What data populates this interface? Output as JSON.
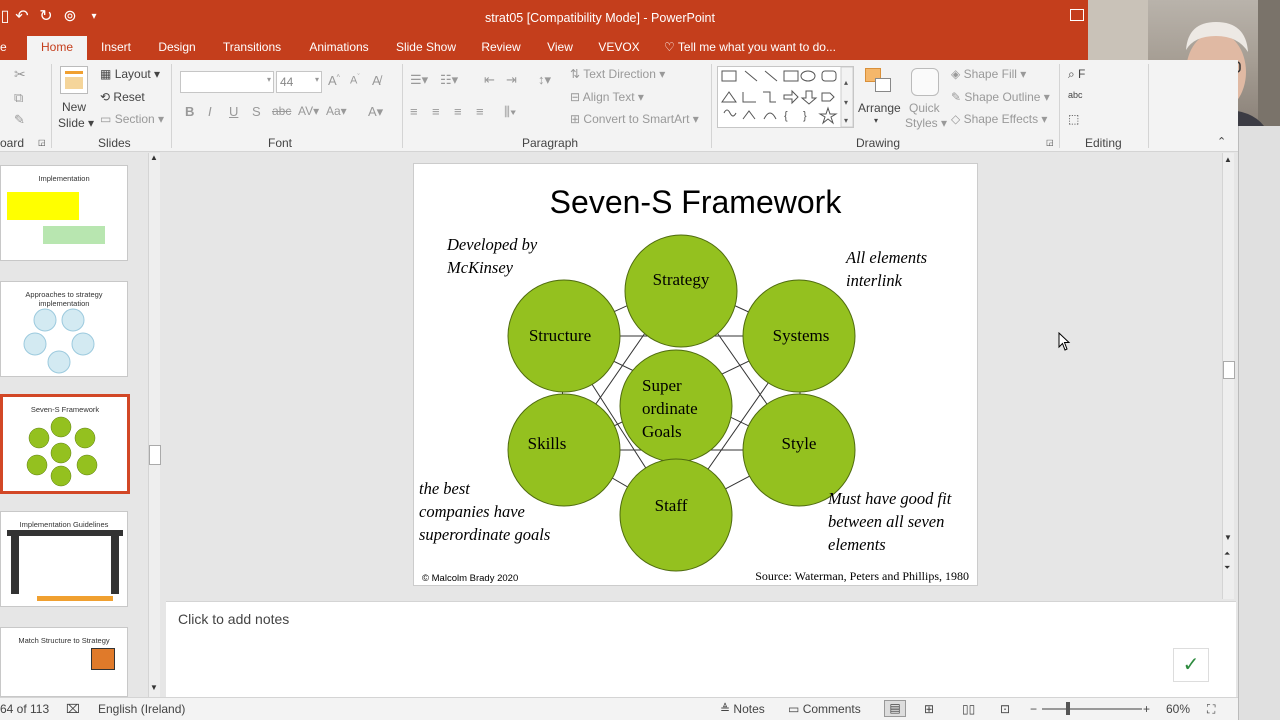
{
  "window": {
    "title": "strat05 [Compatibility Mode] - PowerPoint"
  },
  "ribbon_tabs": [
    {
      "label": "Home",
      "active": true
    },
    {
      "label": "Insert"
    },
    {
      "label": "Design"
    },
    {
      "label": "Transitions"
    },
    {
      "label": "Animations"
    },
    {
      "label": "Slide Show"
    },
    {
      "label": "Review"
    },
    {
      "label": "View"
    },
    {
      "label": "VEVOX"
    }
  ],
  "tell_me": "Tell me what you want to do...",
  "groups": {
    "clipboard": "oard",
    "slides": "Slides",
    "font": "Font",
    "paragraph": "Paragraph",
    "drawing": "Drawing",
    "editing": "Editing"
  },
  "slides_group": {
    "new_slide": "New",
    "new_slide2": "Slide",
    "layout": "Layout",
    "reset": "Reset",
    "section": "Section"
  },
  "font_group": {
    "font_name": "",
    "font_size": "44"
  },
  "paragraph_group": {
    "text_direction": "Text Direction",
    "align_text": "Align Text",
    "convert_smartart": "Convert to SmartArt"
  },
  "drawing_group": {
    "arrange": "Arrange",
    "quick_styles": "Quick",
    "quick_styles2": "Styles",
    "shape_fill": "Shape Fill",
    "shape_outline": "Shape Outline",
    "shape_effects": "Shape Effects"
  },
  "thumbnails": [
    {
      "title": "Implementation"
    },
    {
      "title": "Approaches to strategy implementation"
    },
    {
      "title": "Seven-S Framework"
    },
    {
      "title": "Implementation Guidelines"
    },
    {
      "title": "Match Structure to Strategy"
    }
  ],
  "slide": {
    "title": "Seven-S Framework",
    "developed": "Developed by",
    "developed2": "McKinsey",
    "interlink": "All elements",
    "interlink2": "interlink",
    "best1": "the best",
    "best2": "companies have",
    "best3": "superordinate goals",
    "fit1": "Must have good fit",
    "fit2": "between all seven",
    "fit3": "elements",
    "copyright": "© Malcolm Brady 2020",
    "source": "Source: Waterman, Peters and Phillips, 1980",
    "circles": {
      "strategy": "Strategy",
      "structure": "Structure",
      "systems": "Systems",
      "super1": "Super",
      "super2": "ordinate",
      "super3": "Goals",
      "skills": "Skills",
      "style": "Style",
      "staff": "Staff"
    },
    "circle_fill": "#94c11f"
  },
  "notes_placeholder": "Click to add notes",
  "status": {
    "slide_count": "64 of 113",
    "language": "English (Ireland)",
    "notes": "Notes",
    "comments": "Comments",
    "zoom": "60%"
  },
  "colors": {
    "accent": "#c43e1c",
    "selected_thumb": "#d24726"
  }
}
